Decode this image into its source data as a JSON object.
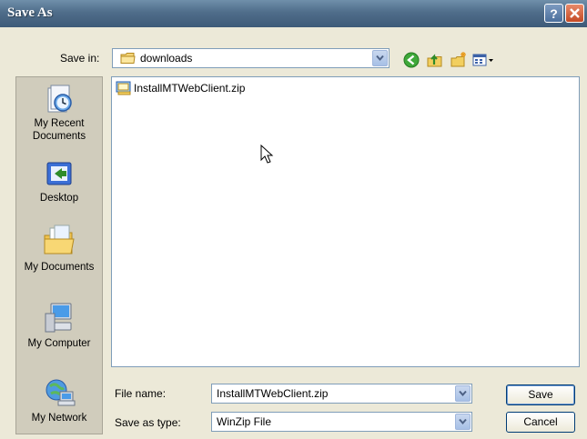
{
  "window": {
    "title": "Save As"
  },
  "save_in": {
    "label": "Save in:",
    "value": "downloads"
  },
  "places": [
    {
      "label_line1": "My Recent",
      "label_line2": "Documents"
    },
    {
      "label_line1": "Desktop",
      "label_line2": ""
    },
    {
      "label_line1": "My Documents",
      "label_line2": ""
    },
    {
      "label_line1": "My Computer",
      "label_line2": ""
    },
    {
      "label_line1": "My Network",
      "label_line2": ""
    }
  ],
  "files": [
    {
      "name": "InstallMTWebClient.zip"
    }
  ],
  "file_name": {
    "label": "File name:",
    "value": "InstallMTWebClient.zip"
  },
  "save_as_type": {
    "label": "Save as type:",
    "value": "WinZip File"
  },
  "buttons": {
    "save": "Save",
    "cancel": "Cancel"
  },
  "icons": {
    "help": "help-icon",
    "close": "close-icon",
    "back": "back-icon",
    "up": "up-folder-icon",
    "new_folder": "new-folder-icon",
    "views": "views-menu-icon"
  },
  "colors": {
    "title_bar": "#4f6d8a",
    "dialog_bg": "#ece9d8",
    "close_button": "#c44a25"
  }
}
